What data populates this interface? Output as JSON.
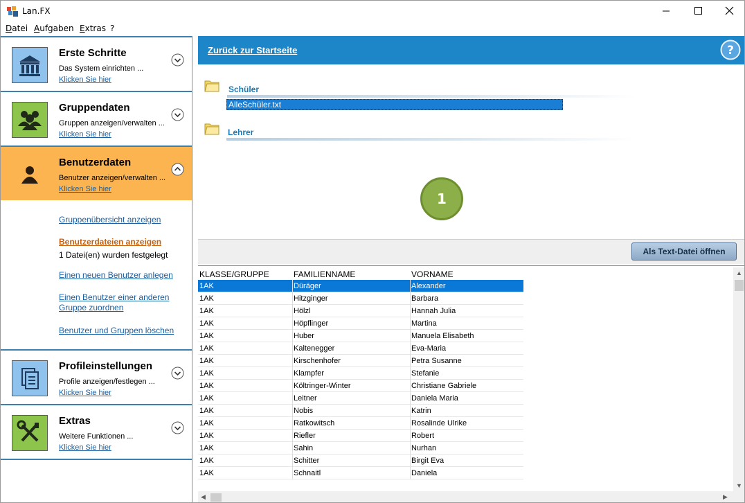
{
  "window": {
    "title": "Lan.FX"
  },
  "menu": [
    {
      "label": "Datei",
      "underline": "D",
      "rest": "atei"
    },
    {
      "label": "Aufgaben",
      "underline": "A",
      "rest": "ufgaben"
    },
    {
      "label": "Extras",
      "underline": "E",
      "rest": "xtras"
    },
    {
      "label": "?",
      "underline": "",
      "rest": "?"
    }
  ],
  "sidebar": {
    "sections": [
      {
        "title": "Erste Schritte",
        "subtitle": "Das System einrichten ...",
        "link": "Klicken Sie hier",
        "icon": "bank-icon",
        "state": "collapsed"
      },
      {
        "title": "Gruppendaten",
        "subtitle": "Gruppen anzeigen/verwalten ...",
        "link": "Klicken Sie hier",
        "icon": "group-icon",
        "state": "collapsed"
      },
      {
        "title": "Benutzerdaten",
        "subtitle": "Benutzer anzeigen/verwalten ...",
        "link": "Klicken Sie hier",
        "icon": "user-icon",
        "state": "expanded"
      },
      {
        "title": "Profileinstellungen",
        "subtitle": "Profile anzeigen/festlegen ...",
        "link": "Klicken Sie hier",
        "icon": "profile-icon",
        "state": "collapsed"
      },
      {
        "title": "Extras",
        "subtitle": "Weitere Funktionen ...",
        "link": "Klicken Sie hier",
        "icon": "tools-icon",
        "state": "collapsed"
      }
    ],
    "sublinks": {
      "groups_overview": "Gruppenübersicht anzeigen",
      "user_files": "Benutzerdateien anzeigen",
      "files_status": "1 Datei(en) wurden festgelegt",
      "new_user": "Einen neuen Benutzer anlegen",
      "assign_user_line1": "Einen Benutzer einer anderen",
      "assign_user_line2": "Gruppe zuordnen",
      "delete": "Benutzer und Gruppen löschen"
    }
  },
  "header": {
    "back_link": "Zurück zur Startseite"
  },
  "content": {
    "groups": [
      {
        "label": "Schüler",
        "file": "AlleSchüler.txt"
      },
      {
        "label": "Lehrer"
      }
    ],
    "badge": "1",
    "open_button": "Als Text-Datei öffnen"
  },
  "table": {
    "columns": [
      "KLASSE/GRUPPE",
      "FAMILIENNAME",
      "VORNAME"
    ],
    "rows": [
      [
        "1AK",
        "Düräger",
        "Alexander"
      ],
      [
        "1AK",
        "Hitzginger",
        "Barbara"
      ],
      [
        "1AK",
        "Hölzl",
        "Hannah Julia"
      ],
      [
        "1AK",
        "Höpflinger",
        "Martina"
      ],
      [
        "1AK",
        "Huber",
        "Manuela Elisabeth"
      ],
      [
        "1AK",
        "Kaltenegger",
        "Eva-Maria"
      ],
      [
        "1AK",
        "Kirschenhofer",
        "Petra Susanne"
      ],
      [
        "1AK",
        "Klampfer",
        "Stefanie"
      ],
      [
        "1AK",
        "Költringer-Winter",
        "Christiane Gabriele"
      ],
      [
        "1AK",
        "Leitner",
        "Daniela Maria"
      ],
      [
        "1AK",
        "Nobis",
        "Katrin"
      ],
      [
        "1AK",
        "Ratkowitsch",
        "Rosalinde Ulrike"
      ],
      [
        "1AK",
        "Riefler",
        "Robert"
      ],
      [
        "1AK",
        "Sahin",
        "Nurhan"
      ],
      [
        "1AK",
        "Schitter",
        "Birgit Eva"
      ],
      [
        "1AK",
        "Schnaitl",
        "Daniela"
      ]
    ],
    "selected_row": 0
  },
  "colors": {
    "accent": "#1d86c8",
    "active_section": "#fbb44f",
    "selection": "#0a78d7",
    "badge": "#8caf49"
  }
}
